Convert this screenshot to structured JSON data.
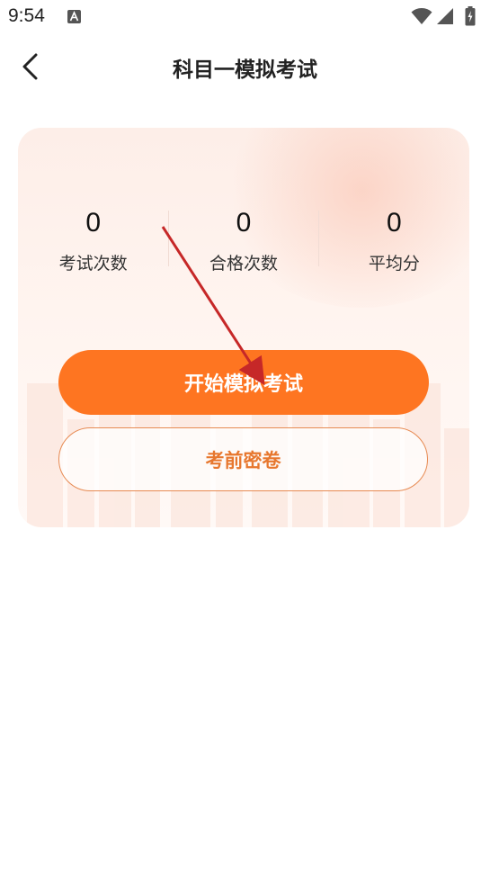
{
  "status_bar": {
    "time": "9:54",
    "icons": [
      "a-notification-icon",
      "wifi-icon",
      "signal-icon",
      "battery-charging-icon"
    ]
  },
  "header": {
    "back_icon": "chevron-left-icon",
    "title": "科目一模拟考试"
  },
  "stats": [
    {
      "value": "0",
      "label": "考试次数"
    },
    {
      "value": "0",
      "label": "合格次数"
    },
    {
      "value": "0",
      "label": "平均分"
    }
  ],
  "actions": {
    "start_label": "开始模拟考试",
    "paper_label": "考前密卷"
  },
  "colors": {
    "accent": "#fe7521",
    "outline": "#e78a52",
    "annotation": "#c62828"
  }
}
